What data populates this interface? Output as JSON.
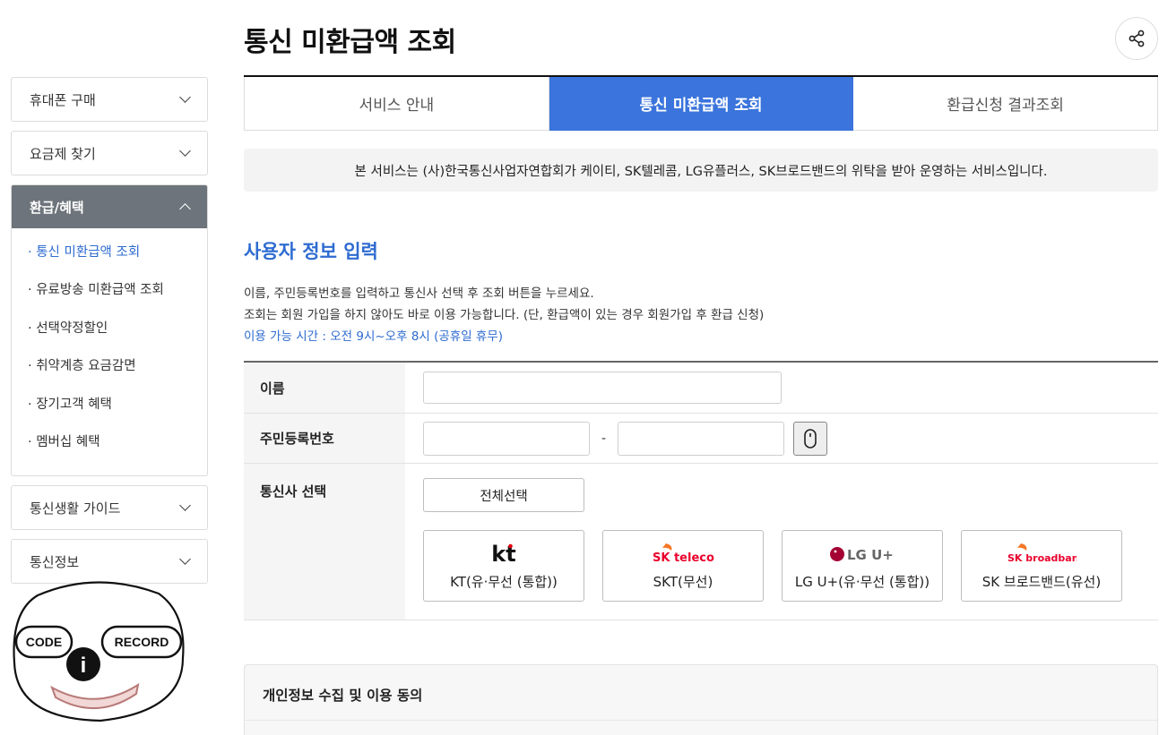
{
  "sidebar": {
    "menus_top": [
      {
        "label": "휴대폰 구매"
      },
      {
        "label": "요금제 찾기"
      }
    ],
    "open_menu": {
      "label": "환급/혜택",
      "items": [
        {
          "label": "통신 미환급액 조회",
          "active": true
        },
        {
          "label": "유료방송 미환급액 조회"
        },
        {
          "label": "선택약정할인"
        },
        {
          "label": "취약계층 요금감면"
        },
        {
          "label": "장기고객 혜택"
        },
        {
          "label": "멤버십 혜택"
        }
      ]
    },
    "menus_bottom": [
      {
        "label": "통신생활 가이드"
      },
      {
        "label": "통신정보"
      }
    ]
  },
  "mascot": {
    "code_label": "CODE",
    "record_label": "RECORD",
    "info_label": "i"
  },
  "header": {
    "title": "통신 미환급액 조회"
  },
  "tabs": [
    {
      "label": "서비스 안내"
    },
    {
      "label": "통신 미환급액 조회",
      "active": true
    },
    {
      "label": "환급신청 결과조회"
    }
  ],
  "notice": "본 서비스는 (사)한국통신사업자연합회가 케이티, SK텔레콤, LG유플러스, SK브로드밴드의 위탁을 받아 운영하는 서비스입니다.",
  "section": {
    "title": "사용자 정보 입력",
    "desc_line1": "이름, 주민등록번호를 입력하고 통신사 선택 후 조회 버튼을 누르세요.",
    "desc_line2": "조회는 회원 가입을 하지 않아도 바로 이용 가능합니다. (단, 환급액이 있는 경우 회원가입 후 환급 신청)",
    "hours": "이용 가능 시간 : 오전 9시~오후 8시 (공휴일 휴무)"
  },
  "form": {
    "name_label": "이름",
    "name_value": "",
    "rrn_label": "주민등록번호",
    "rrn_front": "",
    "rrn_back": "",
    "rrn_sep": "-",
    "carrier_label": "통신사 선택",
    "select_all": "전체선택",
    "carriers": [
      {
        "name": "KT(유·무선 (통합))",
        "logo_text": "kt"
      },
      {
        "name": "SKT(무선)",
        "logo_text": "SK telecom"
      },
      {
        "name": "LG U+(유·무선 (통합))",
        "logo_text": "LG U+"
      },
      {
        "name": "SK 브로드밴드(유선)",
        "logo_text": "SK broadband"
      }
    ]
  },
  "consent": {
    "title": "개인정보 수집 및 이용 동의"
  },
  "colors": {
    "accent": "#3a74dc",
    "sidebar_active": "#6d747b",
    "kt_red": "#e60012",
    "sk_red": "#ea002c",
    "sk_orange": "#f47725",
    "lg_red": "#a50034"
  },
  "icons": [
    "chevron-down-icon",
    "chevron-up-icon",
    "share-icon",
    "mouse-icon"
  ]
}
